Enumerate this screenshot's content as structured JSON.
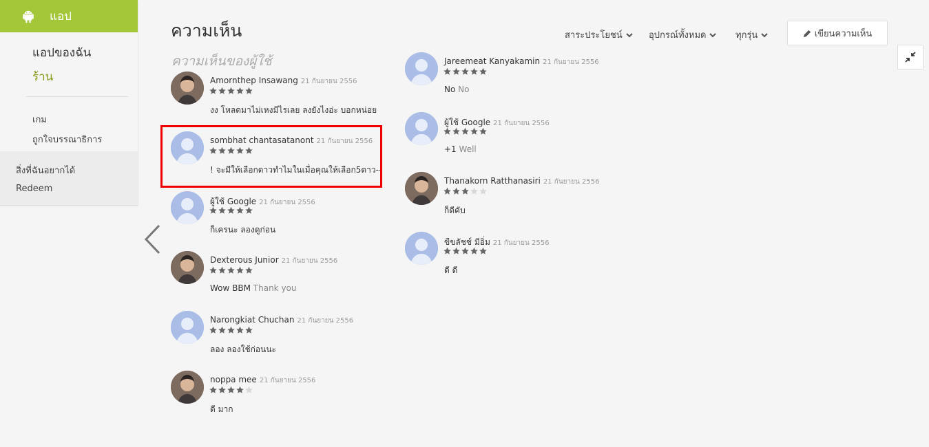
{
  "sidebar": {
    "title": "แอป",
    "my_apps": "แอปของฉัน",
    "store": "ร้าน",
    "games": "เกม",
    "editors_choice": "ถูกใจบรรณาธิการ",
    "wishlist": "สิ่งที่ฉันอยากได้",
    "redeem": "Redeem"
  },
  "header": {
    "title": "ความเห็น",
    "section": "ความเห็นของผู้ใช้",
    "filter_sort": "สาระประโยชน์",
    "filter_device": "อุปกรณ์ทั้งหมด",
    "filter_version": "ทุกรุ่น",
    "write_review": "เขียนความเห็น"
  },
  "colors": {
    "accent": "#a4c639",
    "store_active": "#8a9a1b",
    "star_on": "#666666",
    "star_off": "#d8d8d8",
    "highlight": "#e00000"
  },
  "reviews_left": [
    {
      "name": "Amornthep Insawang",
      "date": "21 กันยายน 2556",
      "stars": 5,
      "text": "งง โหลดมาไม่เหงมีไรเลย ลงยังไงอ่ะ บอกหน่อย",
      "text_dim": "",
      "avatar": "photo"
    },
    {
      "name": "sombhat chantasatanont",
      "date": "21 กันยายน 2556",
      "stars": 5,
      "text": "! จะมีให้เลือกดาวทำไมในเมื่อคุณให้เลือก5ดาว--",
      "text_dim": "",
      "avatar": "default"
    },
    {
      "name": "ผู้ใช้ Google",
      "date": "21 กันยายน 2556",
      "stars": 5,
      "text": "ก็เครนะ ลองดูก่อน",
      "text_dim": "",
      "avatar": "default"
    },
    {
      "name": "Dexterous Junior",
      "date": "21 กันยายน 2556",
      "stars": 5,
      "text": "Wow BBM",
      "text_dim": "Thank you",
      "avatar": "photo"
    },
    {
      "name": "Narongkiat Chuchan",
      "date": "21 กันยายน 2556",
      "stars": 5,
      "text": "ลอง ลองใช้ก่อนนะ",
      "text_dim": "",
      "avatar": "default"
    },
    {
      "name": "noppa mee",
      "date": "21 กันยายน 2556",
      "stars": 4,
      "text": "ดี มาก",
      "text_dim": "",
      "avatar": "photo"
    }
  ],
  "reviews_right": [
    {
      "name": "Jareemeat Kanyakamin",
      "date": "21 กันยายน 2556",
      "stars": 5,
      "text": "No",
      "text_dim": "No",
      "avatar": "default"
    },
    {
      "name": "ผู้ใช้ Google",
      "date": "21 กันยายน 2556",
      "stars": 5,
      "text": "+1",
      "text_dim": "Well",
      "avatar": "default"
    },
    {
      "name": "Thanakorn Ratthanasiri",
      "date": "21 กันยายน 2556",
      "stars": 3,
      "text": "ก็ดีคับ",
      "text_dim": "",
      "avatar": "photo"
    },
    {
      "name": "ขืขลัชช์ มีอิ่ม",
      "date": "21 กันยายน 2556",
      "stars": 5,
      "text": "ดี ดี",
      "text_dim": "",
      "avatar": "default"
    }
  ]
}
